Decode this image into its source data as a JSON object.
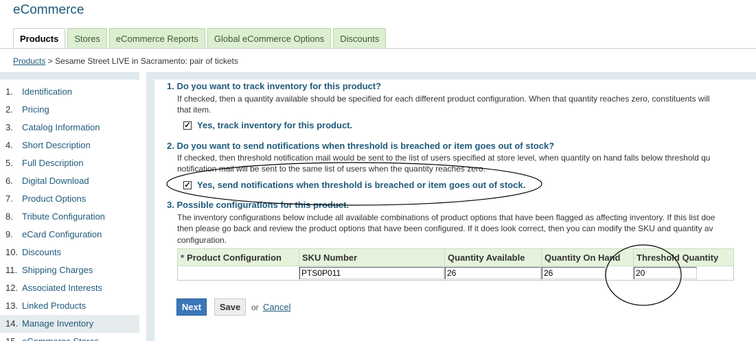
{
  "app": {
    "title": "eCommerce"
  },
  "tabs": [
    {
      "label": "Products",
      "active": true
    },
    {
      "label": "Stores",
      "active": false
    },
    {
      "label": "eCommerce Reports",
      "active": false
    },
    {
      "label": "Global eCommerce Options",
      "active": false
    },
    {
      "label": "Discounts",
      "active": false
    }
  ],
  "breadcrumb": {
    "link": "Products",
    "separator": ">",
    "current": "Sesame Street LIVE in Sacramento: pair of tickets"
  },
  "sidebar": {
    "items": [
      {
        "num": "1.",
        "label": "Identification"
      },
      {
        "num": "2.",
        "label": "Pricing"
      },
      {
        "num": "3.",
        "label": "Catalog Information"
      },
      {
        "num": "4.",
        "label": "Short Description"
      },
      {
        "num": "5.",
        "label": "Full Description"
      },
      {
        "num": "6.",
        "label": "Digital Download"
      },
      {
        "num": "7.",
        "label": "Product Options"
      },
      {
        "num": "8.",
        "label": "Tribute Configuration"
      },
      {
        "num": "9.",
        "label": "eCard Configuration"
      },
      {
        "num": "10.",
        "label": "Discounts"
      },
      {
        "num": "11.",
        "label": "Shipping Charges"
      },
      {
        "num": "12.",
        "label": "Associated Interests"
      },
      {
        "num": "13.",
        "label": "Linked Products"
      },
      {
        "num": "14.",
        "label": "Manage Inventory",
        "active": true
      },
      {
        "num": "15.",
        "label": "eCommerce Stores"
      }
    ]
  },
  "q1": {
    "title": "1. Do you want to track inventory for this product?",
    "desc_line1": "If checked, then a quantity available should be specified for each different product configuration. When that quantity reaches zero, constituents will",
    "desc_line2": "that item.",
    "checkbox_label": "Yes, track inventory for this product.",
    "checked": true
  },
  "q2": {
    "title": "2. Do you want to send notifications when threshold is breached or item goes out of stock?",
    "desc_line1": "If checked, then threshold notification mail would be sent to the list of users specified at store level, when quantity on hand falls below threshold qu",
    "desc_line2": "notification mail will be sent to the same list of users when the quantity reaches zero.",
    "checkbox_label": "Yes, send notifications when threshold is breached or item goes out of stock.",
    "checked": true
  },
  "q3": {
    "title": "3. Possible configurations for this product.",
    "desc_line1": "The inventory configurations below include all available combinations of product options that have been flagged as affecting inventory. If this list doe",
    "desc_line2": "then please go back and review the product options that have been configured. If it does look correct, then you can modify the SKU and quantity av",
    "desc_line3": "configuration."
  },
  "table": {
    "required_mark": "*",
    "headers": {
      "product_configuration": "Product Configuration",
      "sku": "SKU Number",
      "qty_available": "Quantity Available",
      "qty_on_hand": "Quantity On Hand",
      "threshold": "Threshold Quantity"
    },
    "rows": [
      {
        "product_configuration": "",
        "sku": "PTS0P011",
        "qty_available": "26",
        "qty_on_hand": "26",
        "threshold": "20"
      }
    ]
  },
  "actions": {
    "next_label": "Next",
    "save_label": "Save",
    "or_text": "or",
    "cancel_label": "Cancel"
  },
  "colors": {
    "accent": "#1f5a7a",
    "tab_inactive_bg": "#dcefd2",
    "button_primary": "#3a77b8",
    "table_header_bg": "#e6f3dc"
  }
}
